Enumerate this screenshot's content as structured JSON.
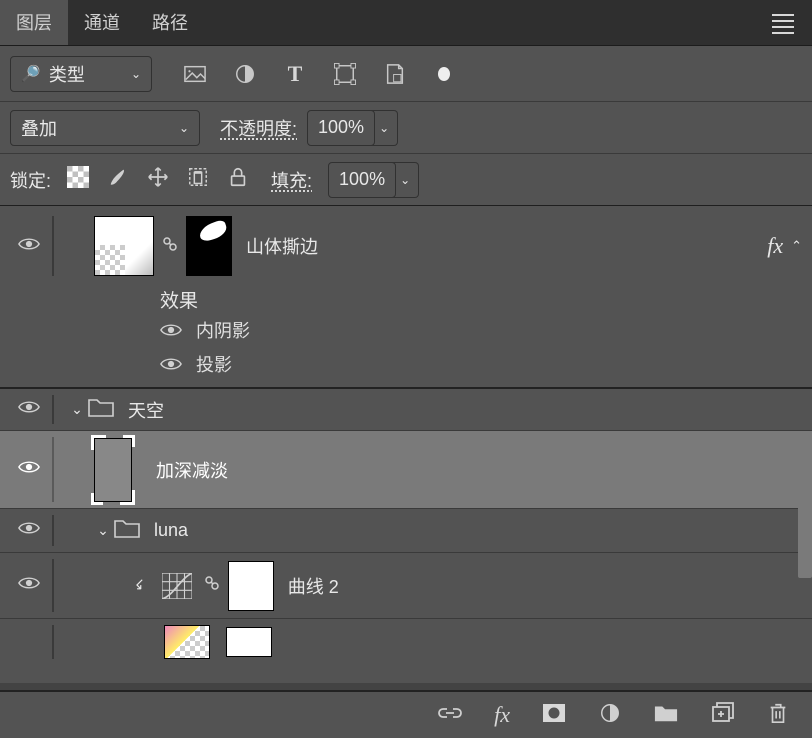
{
  "tabs": {
    "layers": "图层",
    "channels": "通道",
    "paths": "路径"
  },
  "filter": {
    "type_label": "类型"
  },
  "blend": {
    "mode": "叠加",
    "opacity_label": "不透明度:",
    "opacity_value": "100%"
  },
  "lock": {
    "label": "锁定:",
    "fill_label": "填充:",
    "fill_value": "100%"
  },
  "layers": {
    "l0": {
      "name": "山体撕边",
      "fx": "fx"
    },
    "fxheader": "效果",
    "fx1": "内阴影",
    "fx2": "投影",
    "g1": {
      "name": "天空"
    },
    "l1": {
      "name": "加深减淡"
    },
    "g2": {
      "name": "luna"
    },
    "l2": {
      "name": "曲线 2"
    }
  }
}
